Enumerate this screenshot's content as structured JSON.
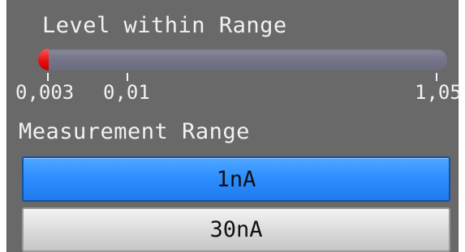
{
  "level": {
    "title": "Level within Range",
    "fraction": 0.025,
    "fill_color": "#e81010",
    "track_color": "#76768a",
    "ticks": [
      "0,003",
      "0,01",
      "1,05"
    ]
  },
  "range": {
    "title": "Measurement Range",
    "options": [
      "1nA",
      "30nA"
    ],
    "selected": "1nA",
    "selected_color": "#2f8fff"
  }
}
